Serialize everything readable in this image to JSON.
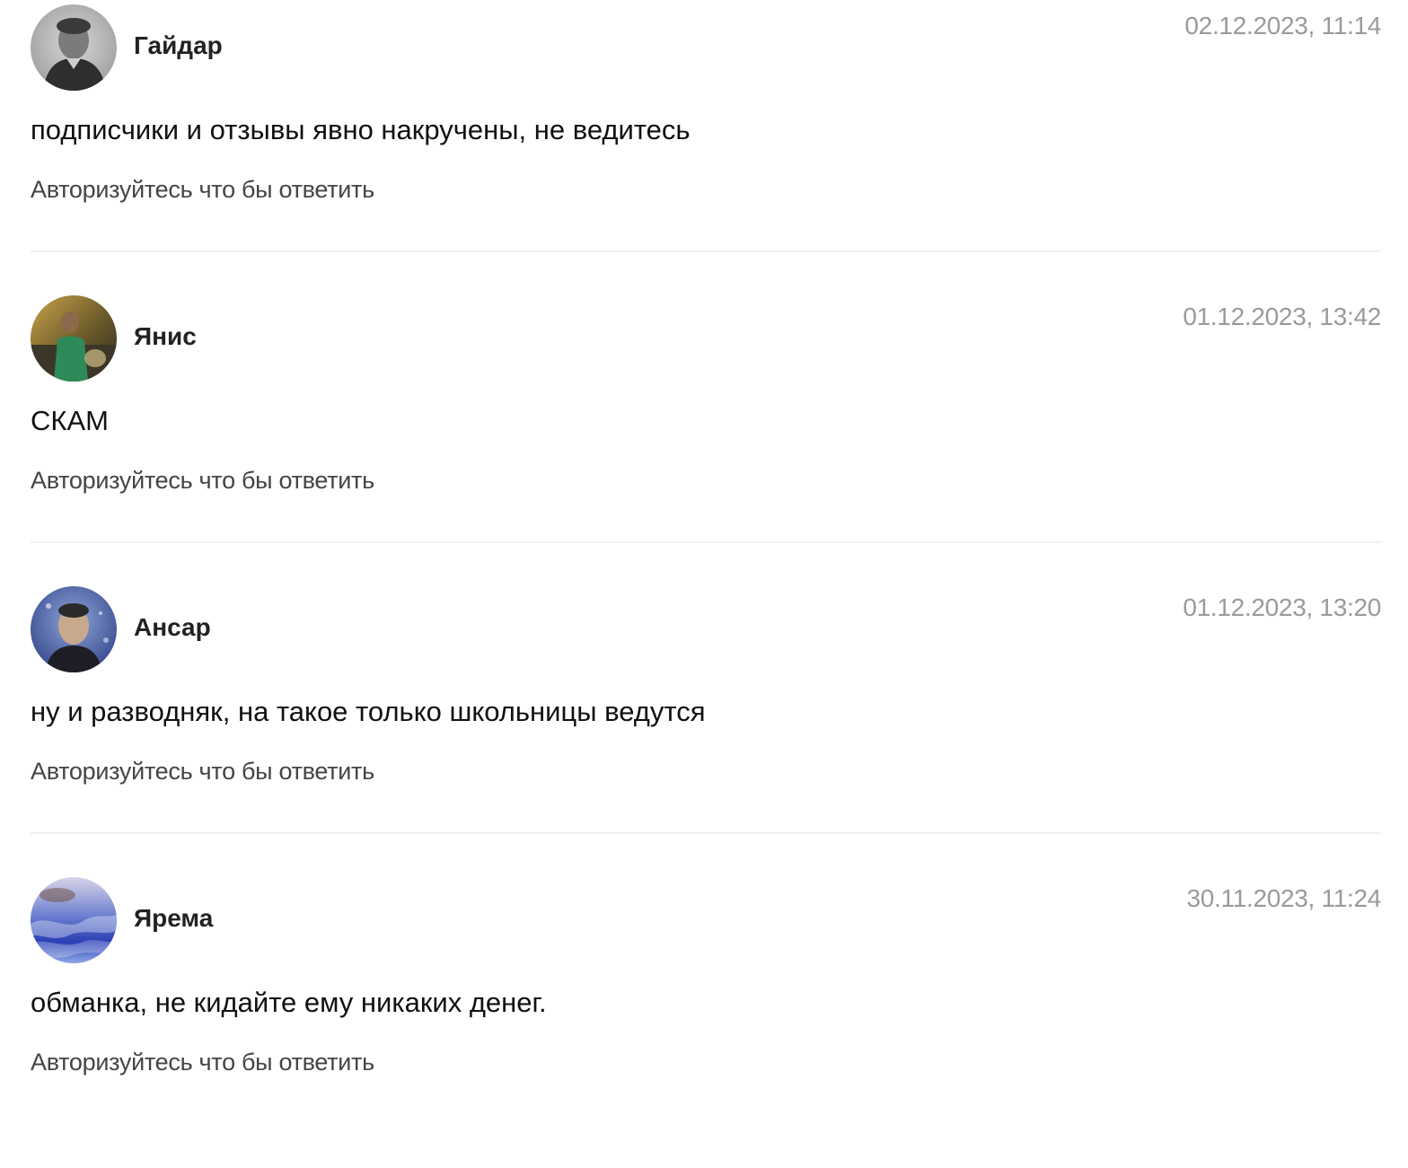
{
  "reply_label": "Авторизуйтесь что бы ответить",
  "colors": {
    "author": "#222222",
    "date": "#9a9a9a",
    "text": "#111111",
    "reply": "#444444",
    "divider": "#f0f0f0"
  },
  "comments": [
    {
      "author": "Гайдар",
      "date": "02.12.2023, 11:14",
      "text": "подписчики и отзывы явно накручены, не ведитесь",
      "avatar": "user-photo-avatar"
    },
    {
      "author": "Янис",
      "date": "01.12.2023, 13:42",
      "text": "СКАМ",
      "avatar": "user-photo-avatar"
    },
    {
      "author": "Ансар",
      "date": "01.12.2023, 13:20",
      "text": "ну и разводняк, на такое только школьницы ведутся",
      "avatar": "user-photo-avatar"
    },
    {
      "author": "Ярема",
      "date": "30.11.2023, 11:24",
      "text": "обманка, не кидайте ему никаких денег.",
      "avatar": "user-photo-avatar"
    }
  ]
}
